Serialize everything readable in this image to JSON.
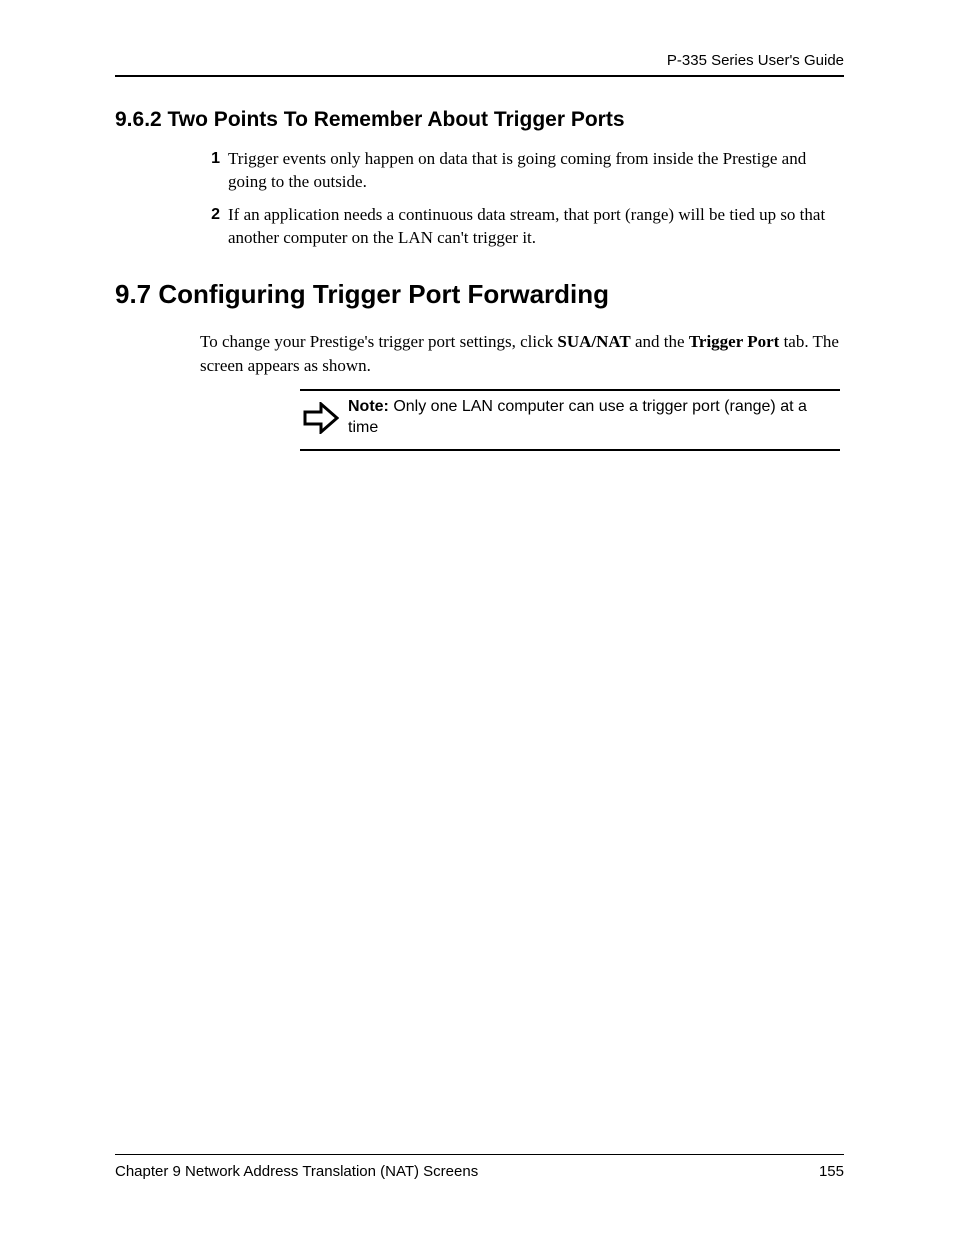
{
  "header": {
    "guide": "P-335 Series User's Guide"
  },
  "section962": {
    "heading": "9.6.2  Two Points To Remember About Trigger Ports",
    "items": [
      {
        "num": "1",
        "text": "Trigger events only happen on data that is going coming from inside the Prestige and going to the outside."
      },
      {
        "num": "2",
        "text": "If an application needs a continuous data stream, that port (range) will be tied up so that another computer on the LAN can't trigger it."
      }
    ]
  },
  "section97": {
    "heading": "9.7  Configuring Trigger Port Forwarding",
    "para_pre": "To change your Prestige's trigger port settings, click ",
    "para_b1": "SUA/NAT",
    "para_mid": " and the ",
    "para_b2": "Trigger Port",
    "para_post": " tab. The screen appears as shown.",
    "note_label": "Note:",
    "note_text": " Only one LAN computer can use a trigger port (range) at a time"
  },
  "footer": {
    "chapter": "Chapter 9 Network Address Translation (NAT) Screens",
    "page": "155"
  }
}
